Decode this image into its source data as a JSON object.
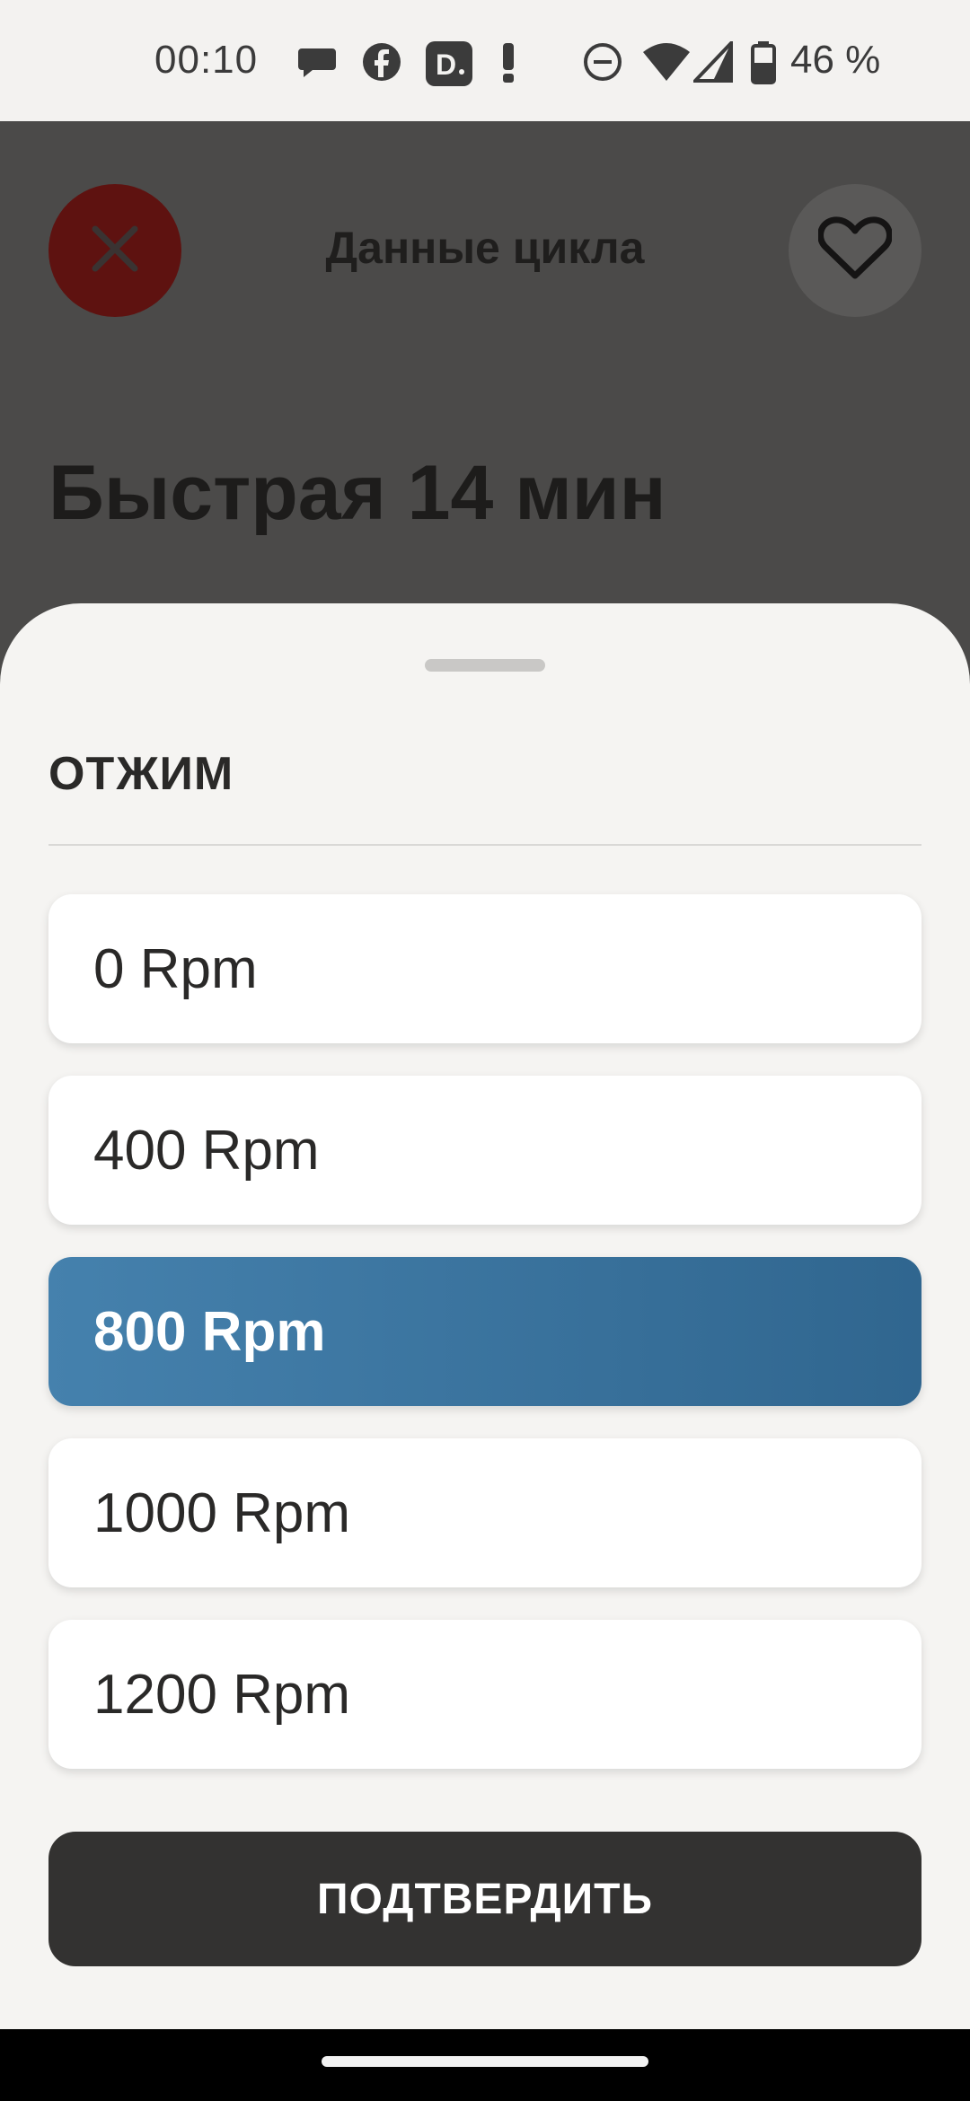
{
  "status_bar": {
    "time": "00:10",
    "battery_percent": "46 %",
    "icons": [
      "chat-icon",
      "facebook-icon",
      "app-d-icon",
      "notification-icon",
      "dnd-icon",
      "wifi-icon",
      "signal-icon",
      "battery-icon"
    ]
  },
  "header": {
    "title": "Данные цикла",
    "close_icon": "close-icon",
    "favorite_icon": "heart-icon"
  },
  "program": {
    "title": "Быстрая 14 мин"
  },
  "sheet": {
    "title": "ОТЖИМ",
    "options": [
      {
        "label": "0 Rpm",
        "selected": false
      },
      {
        "label": "400 Rpm",
        "selected": false
      },
      {
        "label": "800 Rpm",
        "selected": true
      },
      {
        "label": "1000 Rpm",
        "selected": false
      },
      {
        "label": "1200 Rpm",
        "selected": false
      }
    ],
    "confirm_label": "ПОДТВЕРДИТЬ"
  },
  "colors": {
    "selected_gradient_start": "#4581ad",
    "selected_gradient_end": "#30668f",
    "confirm_bg": "#333231",
    "close_bg": "#5e1210",
    "overlay_bg": "#4b4a49"
  }
}
